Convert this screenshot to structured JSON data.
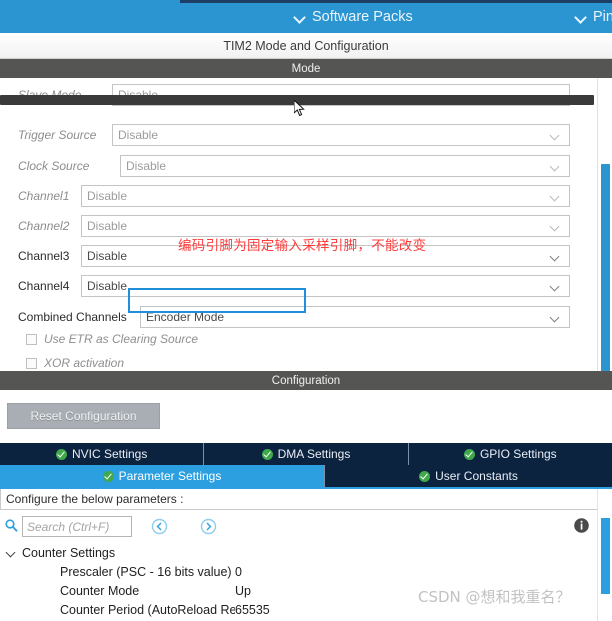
{
  "topbar": {
    "software_packs": "Software Packs",
    "pinout": "Pin",
    "bg_color": "#2b95d2"
  },
  "panel": {
    "title": "TIM2 Mode and Configuration",
    "mode_section_label": "Mode",
    "configuration_section_label": "Configuration"
  },
  "mode_form": {
    "rows": [
      {
        "label": "Slave Mode",
        "value": "Disable",
        "enabled": false
      },
      {
        "label": "Trigger Source",
        "value": "Disable",
        "enabled": false
      },
      {
        "label": "Clock Source",
        "value": "Disable",
        "enabled": false
      },
      {
        "label": "Channel1",
        "value": "Disable",
        "enabled": false
      },
      {
        "label": "Channel2",
        "value": "Disable",
        "enabled": false
      },
      {
        "label": "Channel3",
        "value": "Disable",
        "enabled": true
      },
      {
        "label": "Channel4",
        "value": "Disable",
        "enabled": true
      },
      {
        "label": "Combined Channels",
        "value": "Encoder Mode",
        "enabled": true
      }
    ],
    "checkboxes": [
      {
        "label": "Use ETR as Clearing Source",
        "checked": false
      },
      {
        "label": "XOR activation",
        "checked": false
      }
    ],
    "annotation": "编码引脚为固定输入采样引脚，不能改变",
    "annotation_color": "#ff3b3b",
    "highlight_color": "#1f8fd8"
  },
  "configuration": {
    "reset_button": "Reset Configuration",
    "tabs_row1": [
      {
        "label": "NVIC Settings",
        "active": false
      },
      {
        "label": "DMA Settings",
        "active": false
      },
      {
        "label": "GPIO Settings",
        "active": false
      }
    ],
    "tabs_row2": [
      {
        "label": "Parameter Settings",
        "active": true
      },
      {
        "label": "User Constants",
        "active": false
      }
    ],
    "active_tab_color": "#2b9fe0",
    "inactive_tab_color": "#0c2340"
  },
  "parameters": {
    "note": "Configure the below parameters :",
    "search_placeholder": "Search (Ctrl+F)",
    "search_value": "",
    "group": "Counter Settings",
    "items": [
      {
        "name": "Prescaler (PSC - 16 bits value)",
        "value": "0"
      },
      {
        "name": "Counter Mode",
        "value": "Up"
      },
      {
        "name": "Counter Period (AutoReload Registe...",
        "value": "65535"
      }
    ]
  },
  "watermark": "CSDN @想和我重名？"
}
